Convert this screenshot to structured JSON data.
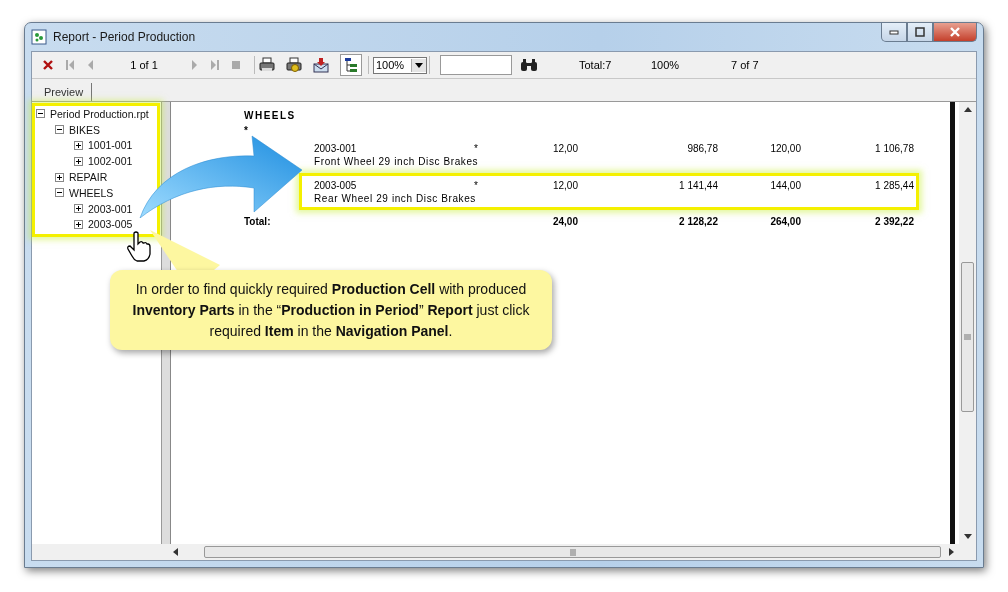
{
  "window": {
    "title": "Report - Period Production"
  },
  "toolbar": {
    "page": "1 of 1",
    "zoom": "100%",
    "group_tree_on": true,
    "total": "Total:7",
    "percent": "100%",
    "records": "7 of 7"
  },
  "tabs": [
    {
      "label": "Preview",
      "selected": true
    }
  ],
  "tree": [
    {
      "label": "Period Production.rpt",
      "expanded": true,
      "children": [
        {
          "label": "BIKES",
          "expanded": true,
          "children": [
            {
              "label": "1001-001",
              "expanded": false
            },
            {
              "label": "1002-001",
              "expanded": false
            }
          ]
        },
        {
          "label": "REPAIR",
          "expanded": false
        },
        {
          "label": "WHEELS",
          "expanded": true,
          "children": [
            {
              "label": "2003-001",
              "expanded": false
            },
            {
              "label": "2003-005",
              "expanded": false
            }
          ]
        }
      ]
    }
  ],
  "report": {
    "group": "WHEELS",
    "marker": "*",
    "rows": [
      {
        "code": "2003-001",
        "flag": "*",
        "description": "Front Wheel 29 inch Disc Brakes",
        "values": [
          "12,00",
          "986,78",
          "120,00",
          "1 106,78"
        ],
        "highlighted": false
      },
      {
        "code": "2003-005",
        "flag": "*",
        "description": "Rear Wheel 29 inch Disc Brakes",
        "values": [
          "12,00",
          "1 141,44",
          "144,00",
          "1 285,44"
        ],
        "highlighted": true
      }
    ],
    "total": {
      "label": "Total:",
      "values": [
        "24,00",
        "2 128,22",
        "264,00",
        "2 392,22"
      ]
    }
  },
  "callout": {
    "text": "In order to find quickly required **Production Cell** with produced **Inventory Parts** in the “**Production in Period**” **Report** just click required **Item** in the **Navigation Panel**."
  }
}
